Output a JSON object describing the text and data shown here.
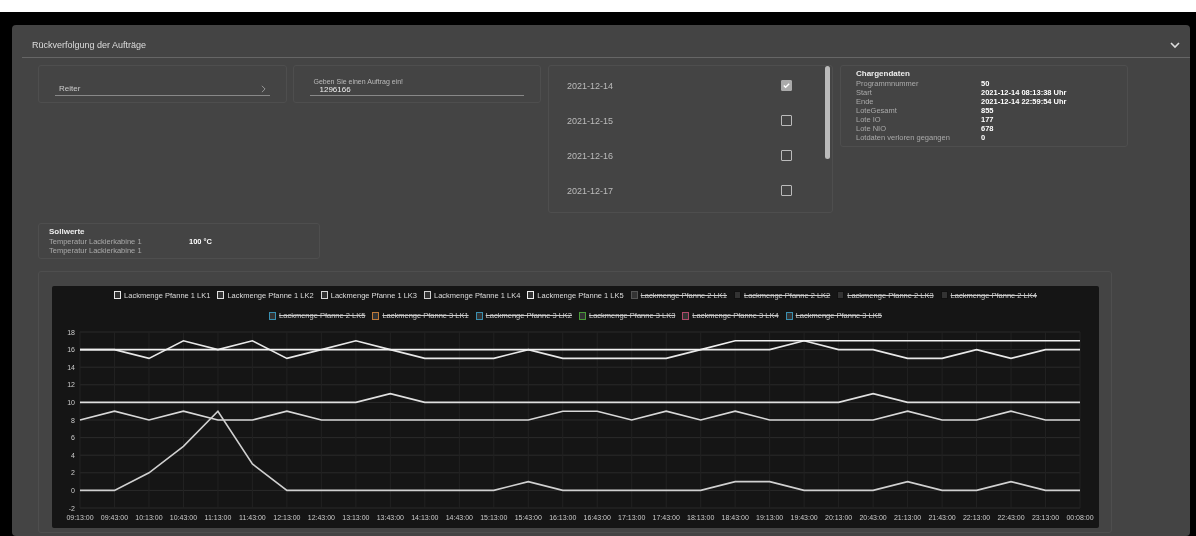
{
  "panel": {
    "title": "Rückverfolgung der Aufträge",
    "expanded": true
  },
  "tab_select": {
    "label": "Reiter"
  },
  "order_field": {
    "label": "Geben Sie einen Auftrag ein!",
    "value": "1296166"
  },
  "dates": [
    {
      "label": "2021-12-14",
      "checked": true
    },
    {
      "label": "2021-12-15",
      "checked": false
    },
    {
      "label": "2021-12-16",
      "checked": false
    },
    {
      "label": "2021-12-17",
      "checked": false
    }
  ],
  "batch_data": {
    "title": "Chargendaten",
    "rows": [
      {
        "label": "Programmnummer",
        "value": "50"
      },
      {
        "label": "Start",
        "value": "2021-12-14 08:13:38 Uhr"
      },
      {
        "label": "Ende",
        "value": "2021-12-14 22:59:54 Uhr"
      },
      {
        "label": "LoteGesamt",
        "value": "855"
      },
      {
        "label": "Lote IO",
        "value": "177"
      },
      {
        "label": "Lote NIO",
        "value": "678"
      },
      {
        "label": "Lotdaten verloren gegangen",
        "value": "0"
      }
    ]
  },
  "setpoints": {
    "title": "Sollwerte",
    "rows": [
      {
        "label": "Temperatur Lackierkabine 1",
        "value": "100 °C"
      },
      {
        "label": "Temperatur Lackierkabine 1"
      }
    ]
  },
  "hidden_legend_items": [
    {
      "name": "Lackmenge Pfanne 2 LK1",
      "color": "#555555"
    },
    {
      "name": "Lackmenge Pfanne 2 LK2",
      "color": "#111111"
    },
    {
      "name": "Lackmenge Pfanne 2 LK3",
      "color": "#111111"
    },
    {
      "name": "Lackmenge Pfanne 2 LK4",
      "color": "#111111"
    },
    {
      "name": "Lackmenge Pfanne 2 LK5",
      "color": "#3a8fb0"
    },
    {
      "name": "Lackmenge Pfanne 3 LK1",
      "color": "#c07a3a"
    },
    {
      "name": "Lackmenge Pfanne 3 LK2",
      "color": "#3a8fb0"
    },
    {
      "name": "Lackmenge Pfanne 3 LK3",
      "color": "#4a9a3a"
    },
    {
      "name": "Lackmenge Pfanne 3 LK4",
      "color": "#b04a6a"
    },
    {
      "name": "Lackmenge Pfanne 3 LK5",
      "color": "#3a8fb0"
    }
  ],
  "chart_data": {
    "type": "line",
    "legend": "top",
    "grid": true,
    "x": [
      "09:13:00",
      "09:43:00",
      "10:13:00",
      "10:43:00",
      "11:13:00",
      "11:43:00",
      "12:13:00",
      "12:43:00",
      "13:13:00",
      "13:43:00",
      "14:13:00",
      "14:43:00",
      "15:13:00",
      "15:43:00",
      "16:13:00",
      "16:43:00",
      "17:13:00",
      "17:43:00",
      "18:13:00",
      "18:43:00",
      "19:13:00",
      "19:43:00",
      "20:13:00",
      "20:43:00",
      "21:13:00",
      "21:43:00",
      "22:13:00",
      "22:43:00",
      "23:13:00",
      "00:08:00"
    ],
    "ylim": [
      -2,
      18
    ],
    "yticks": [
      -2,
      0,
      2,
      4,
      6,
      8,
      10,
      12,
      14,
      16,
      18
    ],
    "series": [
      {
        "name": "Lackmenge Pfanne 1 LK1",
        "color": "#e8e8e8",
        "values": [
          16,
          16,
          15,
          17,
          16,
          17,
          15,
          16,
          17,
          16,
          15,
          15,
          15,
          16,
          15,
          15,
          15,
          15,
          16,
          16,
          16,
          17,
          16,
          16,
          15,
          15,
          16,
          15,
          16,
          16
        ]
      },
      {
        "name": "Lackmenge Pfanne 1 LK2",
        "color": "#e0e0e0",
        "values": [
          10,
          10,
          10,
          10,
          10,
          10,
          10,
          10,
          10,
          11,
          10,
          10,
          10,
          10,
          10,
          10,
          10,
          10,
          10,
          10,
          10,
          10,
          10,
          11,
          10,
          10,
          10,
          10,
          10,
          10
        ]
      },
      {
        "name": "Lackmenge Pfanne 1 LK3",
        "color": "#d8d8d8",
        "values": [
          8,
          9,
          8,
          9,
          8,
          8,
          9,
          8,
          8,
          8,
          8,
          8,
          8,
          8,
          9,
          9,
          8,
          9,
          8,
          9,
          8,
          8,
          8,
          8,
          9,
          8,
          8,
          9,
          8,
          8
        ]
      },
      {
        "name": "Lackmenge Pfanne 1 LK4",
        "color": "#d0d0d0",
        "values": [
          0,
          0,
          2,
          5,
          9,
          3,
          0,
          0,
          0,
          0,
          0,
          0,
          0,
          1,
          0,
          0,
          0,
          0,
          0,
          1,
          1,
          0,
          0,
          0,
          1,
          0,
          0,
          1,
          0,
          0
        ]
      },
      {
        "name": "Lackmenge Pfanne 1 LK5",
        "color": "#f0f0f0",
        "values": [
          16,
          16,
          16,
          16,
          16,
          16,
          16,
          16,
          16,
          16,
          16,
          16,
          16,
          16,
          16,
          16,
          16,
          16,
          16,
          17,
          17,
          17,
          17,
          17,
          17,
          17,
          17,
          17,
          17,
          17
        ]
      }
    ]
  }
}
